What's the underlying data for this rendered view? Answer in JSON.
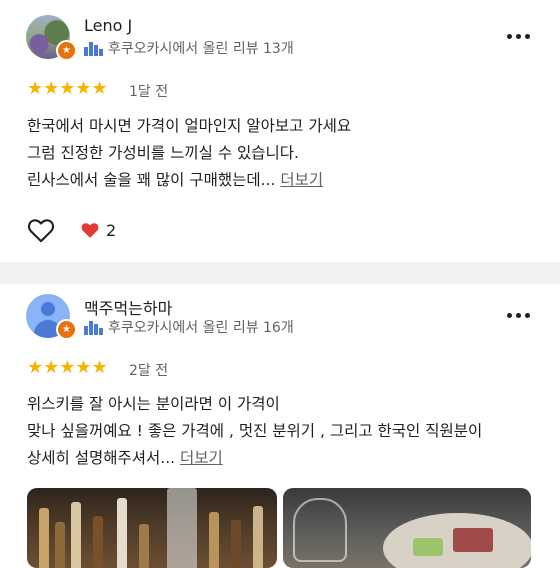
{
  "reviews": [
    {
      "name": "Leno J",
      "meta": "후쿠오카시에서 올린 리뷰 13개",
      "stars": 5,
      "star_glyphs": "★★★★★",
      "time": "1달 전",
      "lines": [
        "한국에서 마시면 가격이 얼마인지 알아보고 가세요",
        "그럼 진정한 가성비를 느끼실 수 있습니다.",
        "린사스에서 술을 꽤 많이 구매했는데..."
      ],
      "more_label": "더보기",
      "reaction_count": "2"
    },
    {
      "name": "맥주먹는하마",
      "meta": "후쿠오카시에서 올린 리뷰 16개",
      "stars": 5,
      "star_glyphs": "★★★★★",
      "time": "2달 전",
      "lines": [
        "위스키를 잘 아시는 분이라면 이 가격이",
        "맞나 싶을꺼예요 ! 좋은 가격에 , 멋진 분위기 , 그리고 한국인 직원분이",
        "상세히 설명해주셔서..."
      ],
      "more_label": "더보기"
    }
  ],
  "colors": {
    "star": "#f4b400",
    "guide_badge": "#e8710a",
    "heart": "#e53935",
    "divider": "#f2f2f2",
    "meta_text": "#5f6368"
  },
  "icons": {
    "guide_badge": "local-guide-star-icon",
    "meta": "city-skyline-icon",
    "more": "more-vert-icon",
    "like": "heart-outline-icon",
    "reaction": "red-heart-icon"
  }
}
